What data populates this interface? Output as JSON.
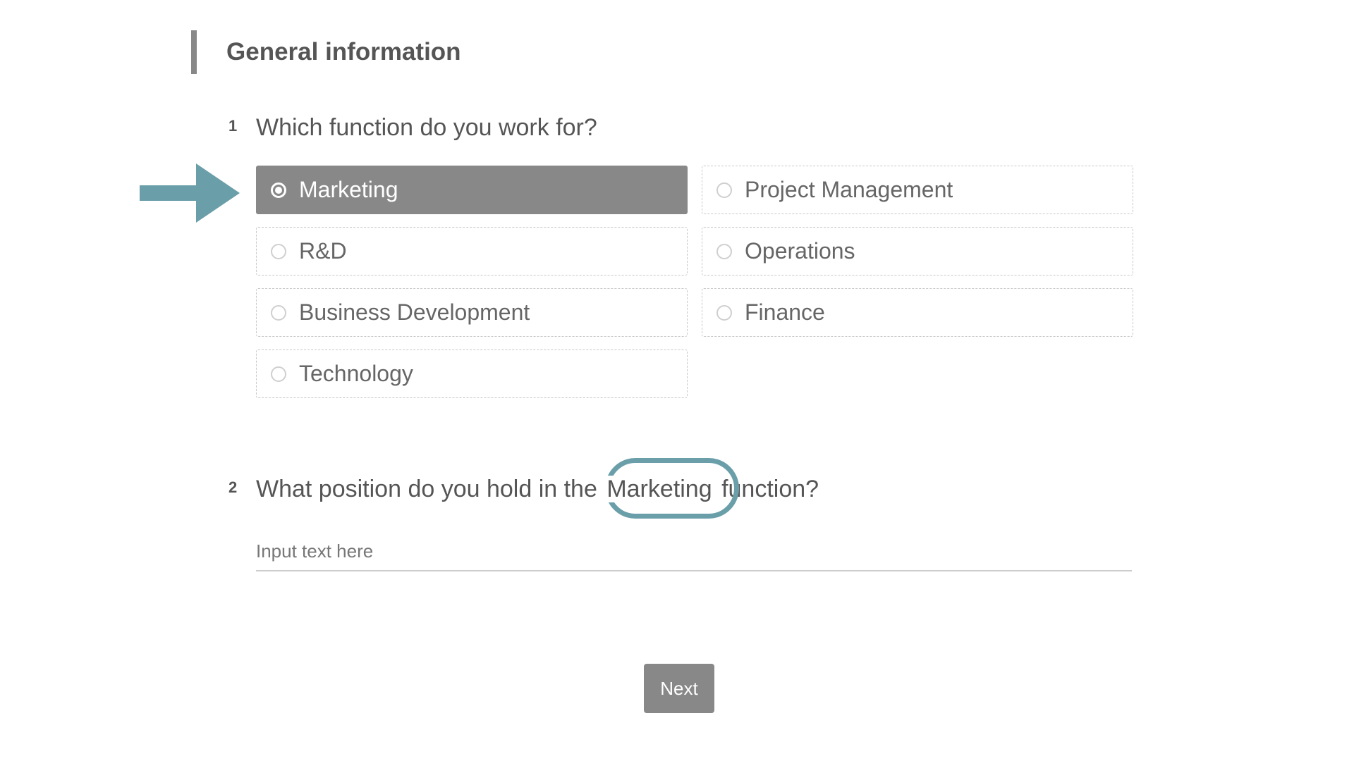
{
  "section": {
    "title": "General information"
  },
  "question1": {
    "number": "1",
    "text": "Which function do you work for?",
    "options": [
      {
        "label": "Marketing",
        "selected": true
      },
      {
        "label": "Project Management",
        "selected": false
      },
      {
        "label": "R&D",
        "selected": false
      },
      {
        "label": "Operations",
        "selected": false
      },
      {
        "label": "Business Development",
        "selected": false
      },
      {
        "label": "Finance",
        "selected": false
      },
      {
        "label": "Technology",
        "selected": false
      }
    ]
  },
  "question2": {
    "number": "2",
    "text_before": "What position do you hold in the",
    "highlight": "Marketing",
    "text_after": "function?",
    "input_value": "",
    "input_placeholder": "Input text here"
  },
  "buttons": {
    "next_label": "Next"
  },
  "colors": {
    "selected_option": "#888888",
    "annotation": "#6a9faa",
    "text": "#555555"
  },
  "icons": {
    "annotation_arrow": "right-arrow-icon",
    "radio_selected": "radio-checked-icon",
    "radio_unselected": "radio-unchecked-icon"
  }
}
